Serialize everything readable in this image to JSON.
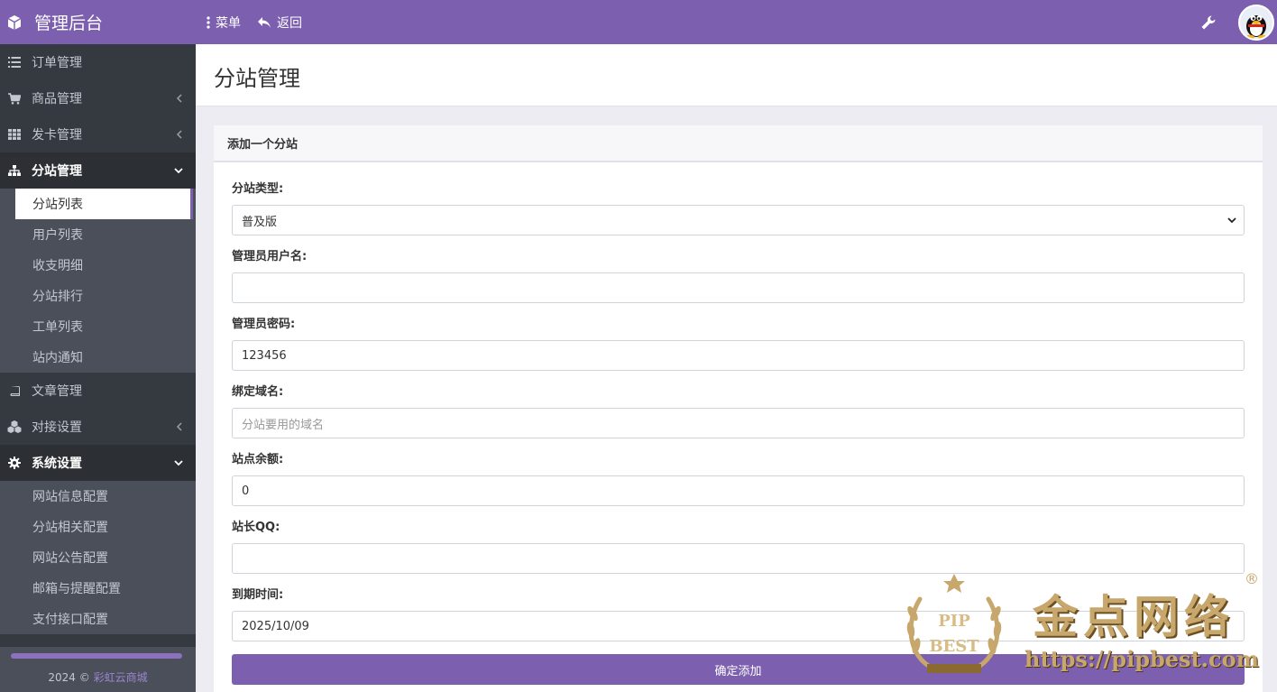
{
  "header": {
    "brand": "管理后台",
    "menu_label": "菜单",
    "back_label": "返回"
  },
  "sidebar": {
    "items": [
      {
        "label": "订单管理",
        "icon": "list-icon"
      },
      {
        "label": "商品管理",
        "icon": "cart-icon"
      },
      {
        "label": "发卡管理",
        "icon": "grid-icon"
      },
      {
        "label": "分站管理",
        "icon": "sitemap-icon"
      },
      {
        "label": "文章管理",
        "icon": "book-icon"
      },
      {
        "label": "对接设置",
        "icon": "cubes-icon"
      },
      {
        "label": "系统设置",
        "icon": "gear-icon"
      }
    ],
    "branch_sub": [
      "分站列表",
      "用户列表",
      "收支明细",
      "分站排行",
      "工单列表",
      "站内通知"
    ],
    "system_sub": [
      "网站信息配置",
      "分站相关配置",
      "网站公告配置",
      "邮箱与提醒配置",
      "支付接口配置"
    ],
    "footer_year": "2024 ©",
    "footer_link": "彩虹云商城"
  },
  "page": {
    "title": "分站管理",
    "card_title": "添加一个分站"
  },
  "form": {
    "type_label": "分站类型:",
    "type_value": "普及版",
    "admin_user_label": "管理员用户名:",
    "admin_user_value": "",
    "admin_pwd_label": "管理员密码:",
    "admin_pwd_value": "123456",
    "domain_label": "绑定域名:",
    "domain_placeholder": "分站要用的域名",
    "balance_label": "站点余额:",
    "balance_value": "0",
    "qq_label": "站长QQ:",
    "qq_value": "",
    "expire_label": "到期时间:",
    "expire_value": "2025/10/09",
    "submit_label": "确定添加"
  },
  "watermark": {
    "text": "金点网络",
    "url": "https://pipbest.com",
    "badge_top": "PIP",
    "badge_bottom": "BEST",
    "reg": "®"
  },
  "colors": {
    "accent": "#7c5fae",
    "sidebar": "#343a40",
    "submenu": "#4b4f5a"
  },
  "sidebar_progress_fraction": 1.0
}
